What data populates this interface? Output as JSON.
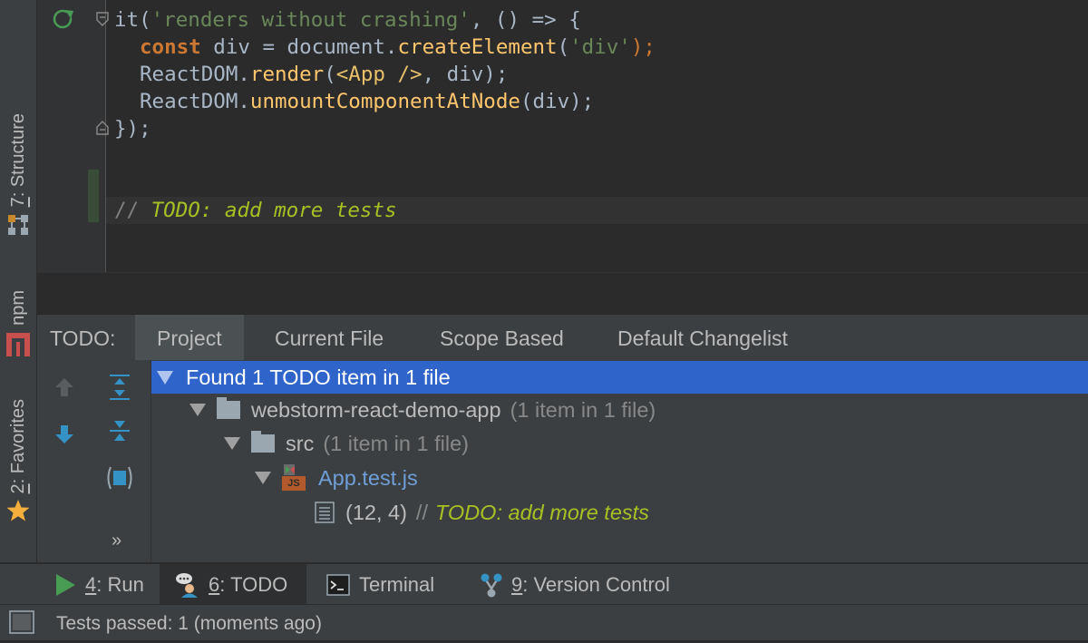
{
  "left_strip": {
    "structure": {
      "num": "7",
      "label": ": Structure"
    },
    "npm": {
      "label": "npm"
    },
    "favorites": {
      "num": "2",
      "label": ": Favorites"
    }
  },
  "editor": {
    "lines": [
      {
        "it": "it(",
        "desc": "'renders without crashing'",
        "rest": ", () => {"
      },
      {
        "kw": "const",
        "a": " div = document.",
        "fn": "createElement",
        "open": "(",
        "str": "'div'",
        "close": ");"
      },
      {
        "obj": "ReactDOM.",
        "fn": "render",
        "open": "(",
        "jsx": "<App />",
        "rest": ", div);"
      },
      {
        "obj": "ReactDOM.",
        "fn": "unmountComponentAtNode",
        "rest": "(div);"
      },
      {
        "close": "});"
      }
    ],
    "todo_comment": {
      "slashes": "// ",
      "text": "TODO: add more tests"
    }
  },
  "todo_panel": {
    "title": "TODO:",
    "tabs": [
      "Project",
      "Current File",
      "Scope Based",
      "Default Changelist"
    ],
    "active_tab": "Project",
    "tree": {
      "summary": "Found 1 TODO item in 1 file",
      "project": {
        "name": "webstorm-react-demo-app",
        "count": "(1 item in 1 file)"
      },
      "folder": {
        "name": "src",
        "count": "(1 item in 1 file)"
      },
      "file": {
        "name": "App.test.js",
        "badge": "JS"
      },
      "item": {
        "pos": "(12, 4)",
        "slashes": "//",
        "text": "TODO: add more tests"
      }
    },
    "toolbar": {
      "more": "»"
    }
  },
  "bottom_bar": {
    "run": {
      "num": "4",
      "label": ": Run"
    },
    "todo": {
      "num": "6",
      "label": ": TODO"
    },
    "terminal": {
      "label": "Terminal"
    },
    "vcs": {
      "num": "9",
      "label": ": Version Control"
    }
  },
  "status": {
    "text": "Tests passed: 1 (moments ago)"
  },
  "colors": {
    "selection": "#2f65ca",
    "accent_blue": "#3592c4",
    "run_green": "#499c54",
    "star": "#f4af3d",
    "npm_red": "#c94f4f"
  }
}
